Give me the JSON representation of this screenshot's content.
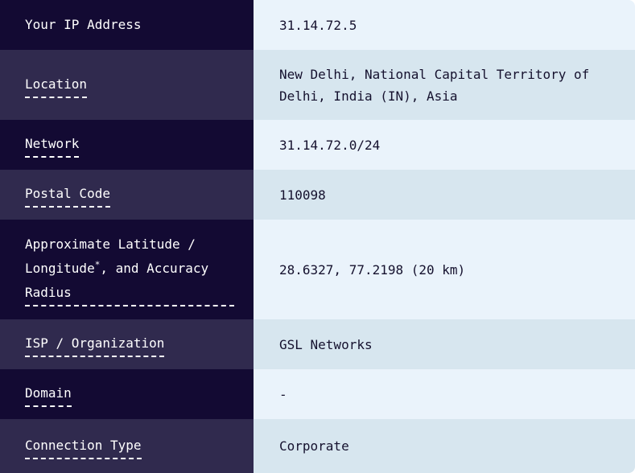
{
  "rows": [
    {
      "label": "Your IP Address",
      "value": "31.14.72.5"
    },
    {
      "label": "Location",
      "value": "New Delhi, National Capital Territory of Delhi, India (IN), Asia"
    },
    {
      "label": "Network",
      "value": "31.14.72.0/24"
    },
    {
      "label": "Postal Code",
      "value": "110098"
    },
    {
      "label_part1": "Approximate Latitude / Longitude",
      "label_sup": "*",
      "label_part2": ", and Accuracy Radius",
      "value": "28.6327, 77.2198 (20 km)"
    },
    {
      "label": "ISP / Organization",
      "value": "GSL Networks"
    },
    {
      "label": "Domain",
      "value": "-"
    },
    {
      "label": "Connection Type",
      "value": "Corporate"
    }
  ]
}
